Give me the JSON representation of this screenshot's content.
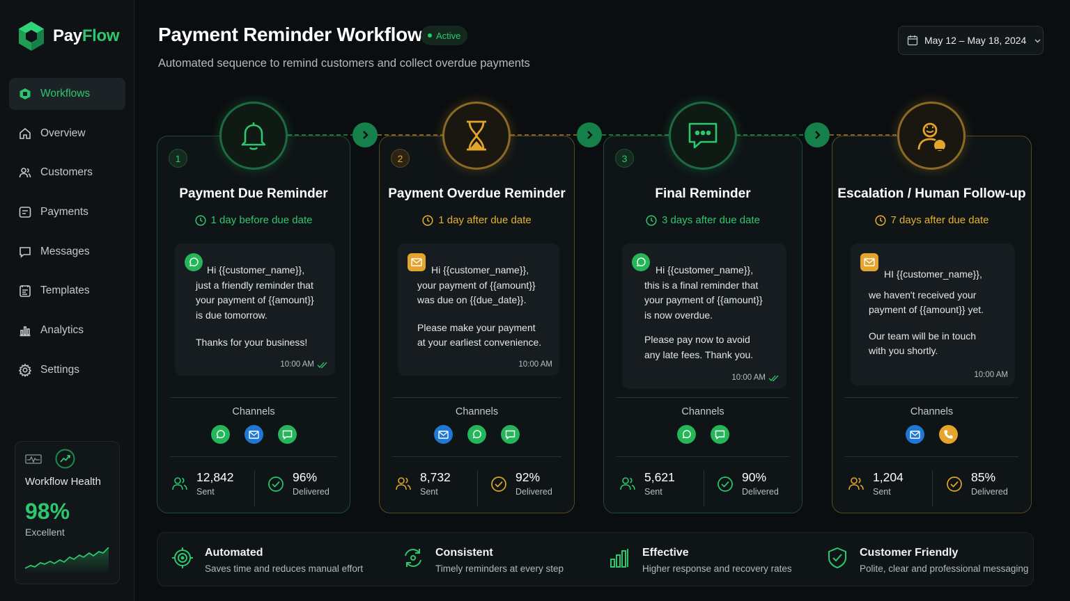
{
  "brand": {
    "part1": "Pay",
    "part2": "Flow"
  },
  "nav": [
    {
      "label": "Workflows",
      "icon": "workflows-icon",
      "active": true
    },
    {
      "label": "Overview",
      "icon": "home-icon"
    },
    {
      "label": "Customers",
      "icon": "users-icon"
    },
    {
      "label": "Payments",
      "icon": "payments-icon"
    },
    {
      "label": "Messages",
      "icon": "message-icon"
    },
    {
      "label": "Templates",
      "icon": "templates-icon"
    },
    {
      "label": "Analytics",
      "icon": "analytics-icon"
    },
    {
      "label": "Settings",
      "icon": "gear-icon"
    }
  ],
  "health": {
    "label": "Workflow Health",
    "value": "98%",
    "status": "Excellent"
  },
  "header": {
    "title": "Payment Reminder Workflow",
    "status": "Active",
    "subtitle": "Automated sequence to remind customers and collect overdue payments",
    "date_range": "May 12 – May 18, 2024"
  },
  "steps": [
    {
      "num": "1",
      "title": "Payment Due Reminder",
      "timing": "1 day before due date",
      "accent": "#2dc76d",
      "message": {
        "lines": [
          "Hi {{customer_name}},",
          "just a friendly reminder that",
          "your payment of {{amount}}",
          "is due tomorrow.",
          "",
          "Thanks for your business!"
        ],
        "time": "10:00 AM"
      },
      "channels_label": "Channels",
      "sent": "12,842",
      "sent_label": "Sent",
      "delivered": "96%",
      "delivered_label": "Delivered"
    },
    {
      "num": "2",
      "title": "Payment Overdue Reminder",
      "timing": "1 day after due date",
      "accent": "#e3a52c",
      "message": {
        "lines": [
          "Hi {{customer_name}},",
          "your payment of {{amount}}",
          "was due on {{due_date}}.",
          "",
          "Please make your payment",
          "at your earliest convenience."
        ],
        "time": "10:00 AM"
      },
      "channels_label": "Channels",
      "sent": "8,732",
      "sent_label": "Sent",
      "delivered": "92%",
      "delivered_label": "Delivered"
    },
    {
      "num": "3",
      "title": "Final Reminder",
      "timing": "3 days after due date",
      "accent": "#2dc76d",
      "message": {
        "lines": [
          "Hi {{customer_name}},",
          "this is a final reminder that",
          "your payment of {{amount}}",
          "is now overdue.",
          "",
          "Please pay now to avoid",
          "any late fees. Thank you."
        ],
        "time": "10:00 AM"
      },
      "channels_label": "Channels",
      "sent": "5,621",
      "sent_label": "Sent",
      "delivered": "90%",
      "delivered_label": "Delivered"
    },
    {
      "num": "",
      "title": "Escalation / Human Follow-up",
      "timing": "7 days after due date",
      "accent": "#e3a52c",
      "message": {
        "lines": [
          "HI {{customer_name}},",
          "",
          "we haven't received your",
          "payment of {{amount}} yet.",
          "",
          "Our team will be in touch",
          "with you shortly."
        ],
        "time": "10:00 AM"
      },
      "channels_label": "Channels",
      "sent": "1,204",
      "sent_label": "Sent",
      "delivered": "85%",
      "delivered_label": "Delivered"
    }
  ],
  "features": [
    {
      "title": "Automated",
      "desc": "Saves time and reduces manual effort"
    },
    {
      "title": "Consistent",
      "desc": "Timely reminders at every step"
    },
    {
      "title": "Effective",
      "desc": "Higher response and recovery rates"
    },
    {
      "title": "Customer Friendly",
      "desc": "Polite, clear and professional messaging"
    }
  ]
}
